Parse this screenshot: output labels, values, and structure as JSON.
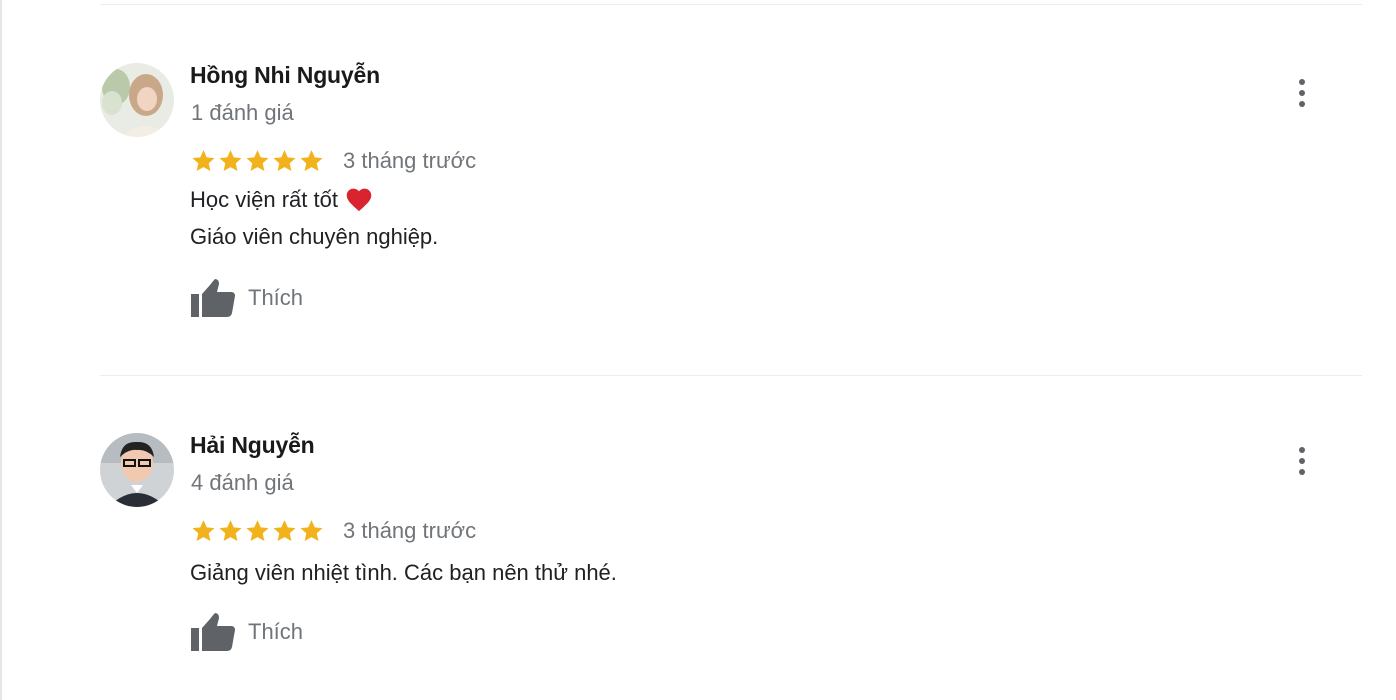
{
  "reviews": [
    {
      "author": "Hồng Nhi Nguyễn",
      "review_count": "1 đánh giá",
      "stars": 5,
      "date": "3 tháng trước",
      "text_lines": [
        "Học viện rất tốt",
        "Giáo viên chuyên nghiệp."
      ],
      "has_heart": true,
      "like_label": "Thích",
      "avatar_icon": "profile-photo"
    },
    {
      "author": "Hải Nguyễn",
      "review_count": "4 đánh giá",
      "stars": 5,
      "date": "3 tháng trước",
      "text_lines": [
        "Giảng viên nhiệt tình. Các bạn nên thử nhé."
      ],
      "has_heart": false,
      "like_label": "Thích",
      "avatar_icon": "profile-photo"
    }
  ],
  "colors": {
    "star": "#F2B21B",
    "heart": "#D9232E",
    "secondary_text": "#70757A",
    "icon_gray": "#5F6368"
  },
  "icons": [
    "star-icon",
    "heart-icon",
    "thumbs-up-icon",
    "more-vert-icon"
  ]
}
